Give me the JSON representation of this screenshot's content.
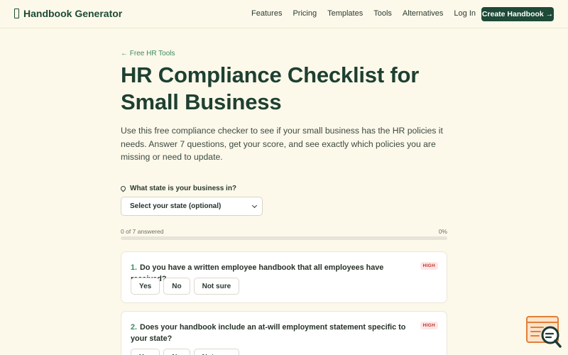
{
  "header": {
    "brand": "Handbook Generator",
    "nav": [
      "Features",
      "Pricing",
      "Templates",
      "Tools",
      "Alternatives",
      "Log In"
    ],
    "cta": "Create Handbook →"
  },
  "main": {
    "back_link": "← Free HR Tools",
    "title": "HR Compliance Checklist for Small Business",
    "intro": "Use this free compliance checker to see if your small business has the HR policies it needs. Answer 7 questions, get your score, and see exactly which policies you are missing or need to update."
  },
  "state": {
    "label": "What state is your business in?",
    "select_value": "Select your state (optional)"
  },
  "progress": {
    "answered_text": "0 of 7 answered",
    "percent_text": "0%",
    "fraction": 0
  },
  "questions": [
    {
      "number": "1.",
      "text": "Do you have a written employee handbook that all employees have received?",
      "badge": "HIGH",
      "answers": [
        "Yes",
        "No",
        "Not sure"
      ]
    },
    {
      "number": "2.",
      "text": "Does your handbook include an at-will employment statement specific to your state?",
      "badge": "HIGH",
      "answers": [
        "Yes",
        "No",
        "Not sure"
      ]
    }
  ],
  "colors": {
    "background": "#fdf9ea",
    "brand": "#1e4a37",
    "accent": "#3a8a5e",
    "badge_bg": "#fde8e8",
    "badge_text": "#c2332e"
  },
  "icons": {
    "logo": "book-icon",
    "state": "map-pin-icon",
    "select": "chevron-down-icon",
    "widget": "chat-search-icon"
  }
}
